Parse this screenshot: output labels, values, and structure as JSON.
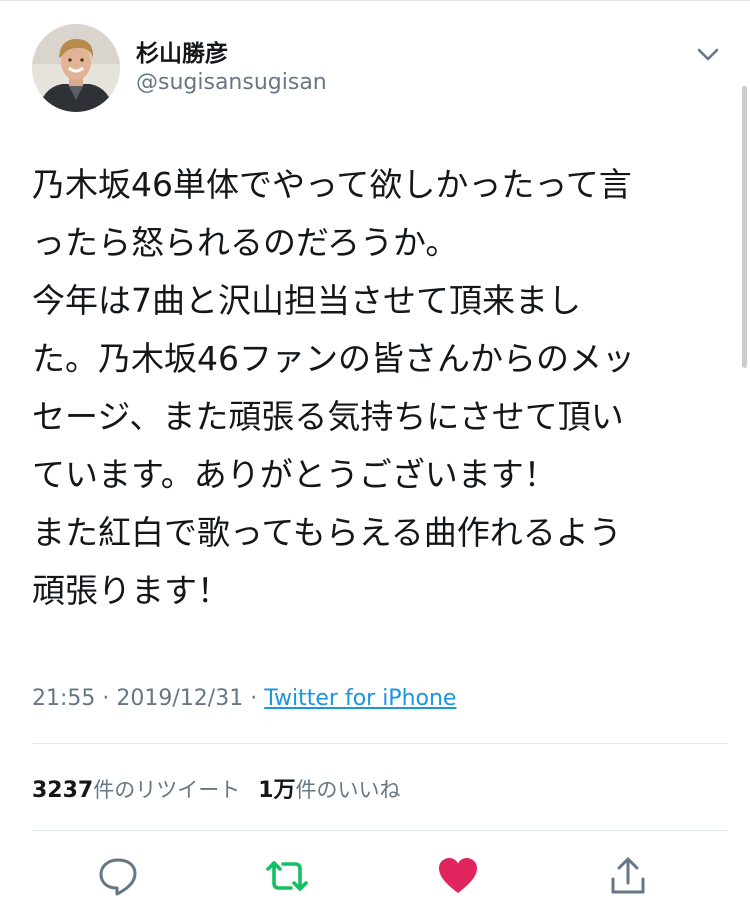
{
  "tweet": {
    "display_name": "杉山勝彦",
    "handle": "@sugisansugisan",
    "text_lines": [
      "乃木坂46単体でやって欲しかったって言",
      "ったら怒られるのだろうか。",
      "今年は7曲と沢山担当させて頂来まし",
      "た。乃木坂46ファンの皆さんからのメッ",
      "セージ、また頑張る気持ちにさせて頂い",
      "ています。ありがとうございます！",
      "また紅白で歌ってもらえる曲作れるよう",
      "頑張ります！"
    ],
    "time": "21:55",
    "separator": "·",
    "date": "2019/12/31",
    "source": "Twitter for iPhone"
  },
  "stats": {
    "retweet_count": "3237",
    "retweet_label": "件のリツイート",
    "like_count": "1万",
    "like_label": "件のいいね"
  },
  "icons": {
    "menu": "chevron-down-icon",
    "reply": "reply-icon",
    "retweet": "retweet-icon",
    "like": "heart-icon",
    "share": "share-icon"
  },
  "colors": {
    "retweet_green": "#17bf63",
    "like_red": "#e0245e",
    "link_blue": "#1b95e0",
    "secondary_text": "#657786"
  }
}
